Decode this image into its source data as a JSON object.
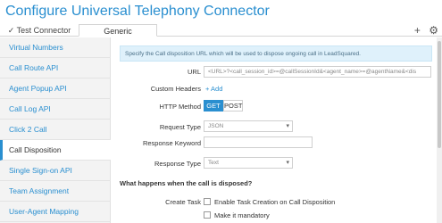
{
  "window": {
    "title": "Configure Universal Telephony Connector"
  },
  "tabs": [
    {
      "label": "✓ Test Connector"
    },
    {
      "label": "Generic"
    }
  ],
  "tab_actions": {
    "add_icon": "+",
    "settings_icon": "⚙"
  },
  "sidebar": {
    "items": [
      {
        "label": "Virtual Numbers"
      },
      {
        "label": "Call Route API"
      },
      {
        "label": "Agent Popup API"
      },
      {
        "label": "Call Log API"
      },
      {
        "label": "Click 2 Call"
      },
      {
        "label": "Call Disposition"
      },
      {
        "label": "Single Sign-on API"
      },
      {
        "label": "Team Assignment"
      },
      {
        "label": "User-Agent Mapping"
      }
    ],
    "active_index": 5
  },
  "main": {
    "info_text": "Specify the Call disposition URL which will be used to dispose ongoing call in LeadSquared.",
    "url_label": "URL",
    "url_value": "<URL>?<call_session_id>=@callSessionId&<agent_name>=@agentName&<dis",
    "custom_headers_label": "Custom Headers",
    "add_label": "+ Add",
    "http_method_label": "HTTP Method",
    "methods": [
      "GET",
      "POST"
    ],
    "selected_method": "GET",
    "request_type_label": "Request Type",
    "request_type_value": "JSON",
    "response_keyword_label": "Response Keyword",
    "response_keyword_value": "",
    "response_type_label": "Response Type",
    "response_type_value": "Text",
    "dispose_heading": "What happens when the call is disposed?",
    "create_task_label": "Create Task",
    "enable_task_label": "Enable Task Creation on Call Disposition",
    "mandatory_label": "Make it mandatory"
  }
}
